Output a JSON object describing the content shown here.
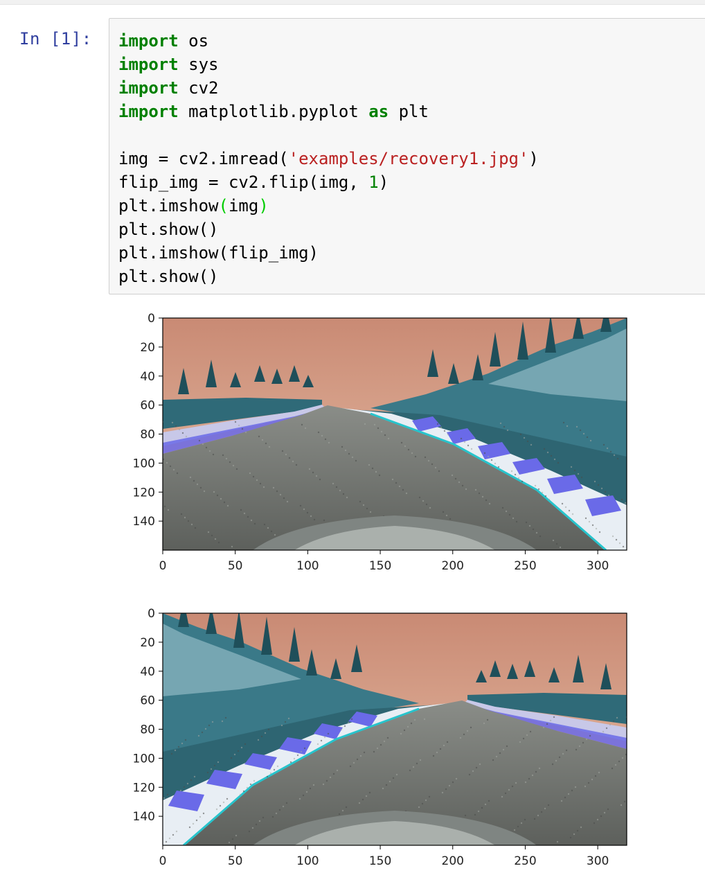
{
  "notebook": {
    "cell": {
      "prompt": "In [1]:",
      "lines": [
        [
          {
            "t": "import",
            "c": "kw"
          },
          {
            "t": " os",
            "c": ""
          }
        ],
        [
          {
            "t": "import",
            "c": "kw"
          },
          {
            "t": " sys",
            "c": ""
          }
        ],
        [
          {
            "t": "import",
            "c": "kw"
          },
          {
            "t": " cv2",
            "c": ""
          }
        ],
        [
          {
            "t": "import",
            "c": "kw"
          },
          {
            "t": " matplotlib.pyplot ",
            "c": ""
          },
          {
            "t": "as",
            "c": "kw"
          },
          {
            "t": " plt",
            "c": ""
          }
        ],
        [],
        [
          {
            "t": "img = cv2.imread(",
            "c": ""
          },
          {
            "t": "'examples/recovery1.jpg'",
            "c": "str"
          },
          {
            "t": ")",
            "c": ""
          }
        ],
        [
          {
            "t": "flip_img = cv2.flip(img, ",
            "c": ""
          },
          {
            "t": "1",
            "c": "num"
          },
          {
            "t": ")",
            "c": ""
          }
        ],
        [
          {
            "t": "plt.imshow",
            "c": ""
          },
          {
            "t": "(",
            "c": "paren-hl"
          },
          {
            "t": "img",
            "c": ""
          },
          {
            "t": ")",
            "c": "paren-hl"
          }
        ],
        [
          {
            "t": "plt.show()",
            "c": ""
          }
        ],
        [
          {
            "t": "plt.imshow(flip_img)",
            "c": ""
          }
        ],
        [
          {
            "t": "plt.show()",
            "c": ""
          }
        ]
      ]
    }
  },
  "chart_data": [
    {
      "type": "image",
      "image_content": "road-camera-frame-original",
      "xlim": [
        0,
        320
      ],
      "ylim": [
        160,
        0
      ],
      "xticks": [
        0,
        50,
        100,
        150,
        200,
        250,
        300
      ],
      "yticks": [
        0,
        20,
        40,
        60,
        80,
        100,
        120,
        140
      ],
      "curb_side": "right"
    },
    {
      "type": "image",
      "image_content": "road-camera-frame-flipped",
      "xlim": [
        0,
        320
      ],
      "ylim": [
        160,
        0
      ],
      "xticks": [
        0,
        50,
        100,
        150,
        200,
        250,
        300
      ],
      "yticks": [
        0,
        20,
        40,
        60,
        80,
        100,
        120,
        140
      ],
      "curb_side": "left"
    }
  ],
  "colors": {
    "sky": "#d9a088",
    "terrain": "#3d7a88",
    "road": "#6f716e",
    "curb_stripe": "#6a6ae8",
    "curb_white": "#e8eef4"
  }
}
